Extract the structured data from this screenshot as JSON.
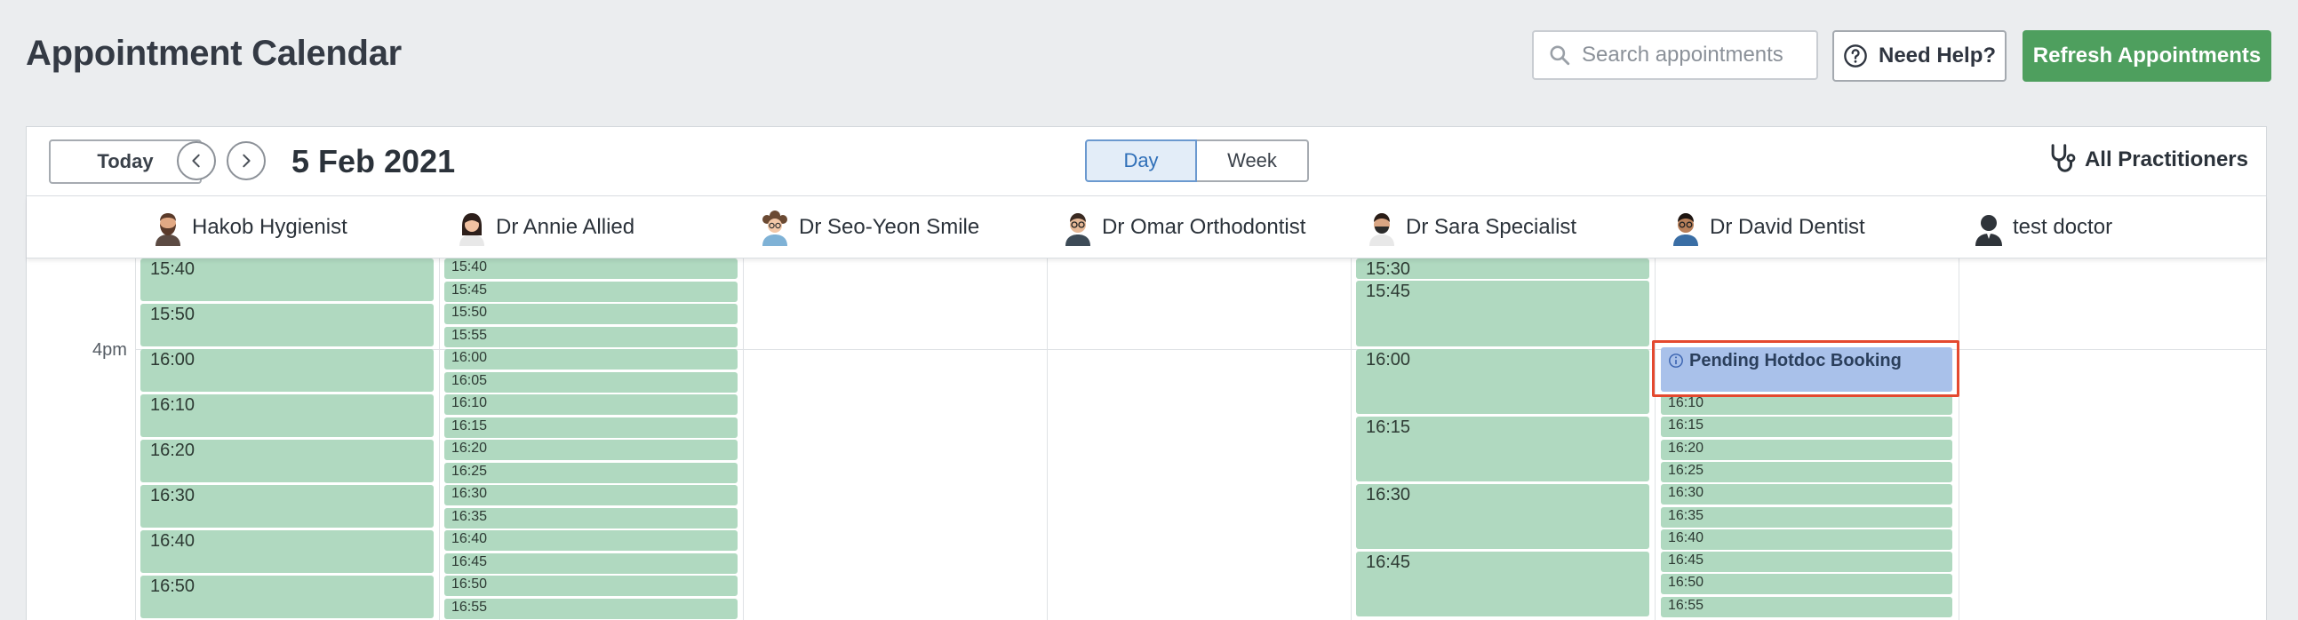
{
  "page": {
    "title": "Appointment Calendar"
  },
  "search": {
    "placeholder": "Search appointments"
  },
  "help": {
    "label": "Need Help?"
  },
  "refresh": {
    "label": "Refresh Appointments"
  },
  "toolbar": {
    "today_label": "Today",
    "date": "5 Feb 2021",
    "views": [
      "Day",
      "Week"
    ],
    "active_view": "Day",
    "practitioner_filter": "All Practitioners"
  },
  "practitioners": [
    "Hakob Hygienist",
    "Dr Annie Allied",
    "Dr Seo-Yeon Smile",
    "Dr Omar Orthodontist",
    "Dr Sara Specialist",
    "Dr David Dentist",
    "test doctor"
  ],
  "grid": {
    "hour_label": "4pm",
    "col0_slots": [
      "15:40",
      "15:50",
      "16:00",
      "16:10",
      "16:20",
      "16:30",
      "16:40",
      "16:50"
    ],
    "col1_slots": [
      "15:40",
      "15:45",
      "15:50",
      "15:55",
      "16:00",
      "16:05",
      "16:10",
      "16:15",
      "16:20",
      "16:25",
      "16:30",
      "16:35",
      "16:40",
      "16:45",
      "16:50",
      "16:55"
    ],
    "col4_slots": [
      "15:30",
      "15:45",
      "16:00",
      "16:15",
      "16:30",
      "16:45"
    ],
    "col5_pending": "Pending Hotdoc Booking",
    "col5_slots": [
      "16:10",
      "16:15",
      "16:20",
      "16:25",
      "16:30",
      "16:35",
      "16:40",
      "16:45",
      "16:50",
      "16:55"
    ]
  },
  "colors": {
    "accent_green": "#4e9f5e",
    "slot_green": "#b0d9c0",
    "pending_blue": "#a9c1ea",
    "highlight_red": "#e4492f"
  }
}
